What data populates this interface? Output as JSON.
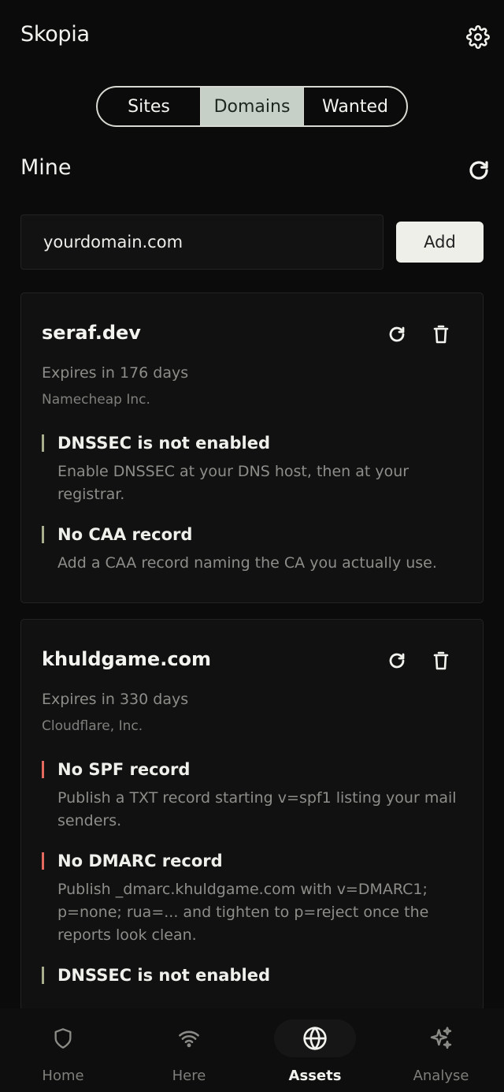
{
  "header": {
    "title": "Skopia",
    "settings_icon": "gear-icon"
  },
  "tabs": [
    {
      "label": "Sites",
      "active": false
    },
    {
      "label": "Domains",
      "active": true
    },
    {
      "label": "Wanted",
      "active": false
    }
  ],
  "section": {
    "title": "Mine",
    "refresh_icon": "refresh-icon"
  },
  "add_domain": {
    "input_value": "yourdomain.com",
    "button_label": "Add"
  },
  "domains": [
    {
      "name": "seraf.dev",
      "expiry": "Expires in 176 days",
      "registrar": "Namecheap Inc.",
      "issues": [
        {
          "title": "DNSSEC is not enabled",
          "desc": "Enable DNSSEC at your DNS host, then at your registrar.",
          "severity": "warning"
        },
        {
          "title": "No CAA record",
          "desc": "Add a CAA record naming the CA you actually use.",
          "severity": "warning"
        }
      ]
    },
    {
      "name": "khuldgame.com",
      "expiry": "Expires in 330 days",
      "registrar": "Cloudflare, Inc.",
      "issues": [
        {
          "title": "No SPF record",
          "desc": "Publish a TXT record starting v=spf1 listing your mail senders.",
          "severity": "error"
        },
        {
          "title": "No DMARC record",
          "desc": "Publish _dmarc.khuldgame.com with v=DMARC1; p=none; rua=... and tighten to p=reject once the reports look clean.",
          "severity": "error"
        },
        {
          "title": "DNSSEC is not enabled",
          "desc": "",
          "severity": "warning"
        }
      ]
    }
  ],
  "colors": {
    "warning": "#a8ad8e",
    "error": "#e46a60",
    "active_tab": "#c6d0c7"
  },
  "nav": [
    {
      "label": "Home",
      "icon": "shield-icon",
      "active": false
    },
    {
      "label": "Here",
      "icon": "wifi-icon",
      "active": false
    },
    {
      "label": "Assets",
      "icon": "globe-icon",
      "active": true
    },
    {
      "label": "Analyse",
      "icon": "sparkles-icon",
      "active": false
    }
  ]
}
